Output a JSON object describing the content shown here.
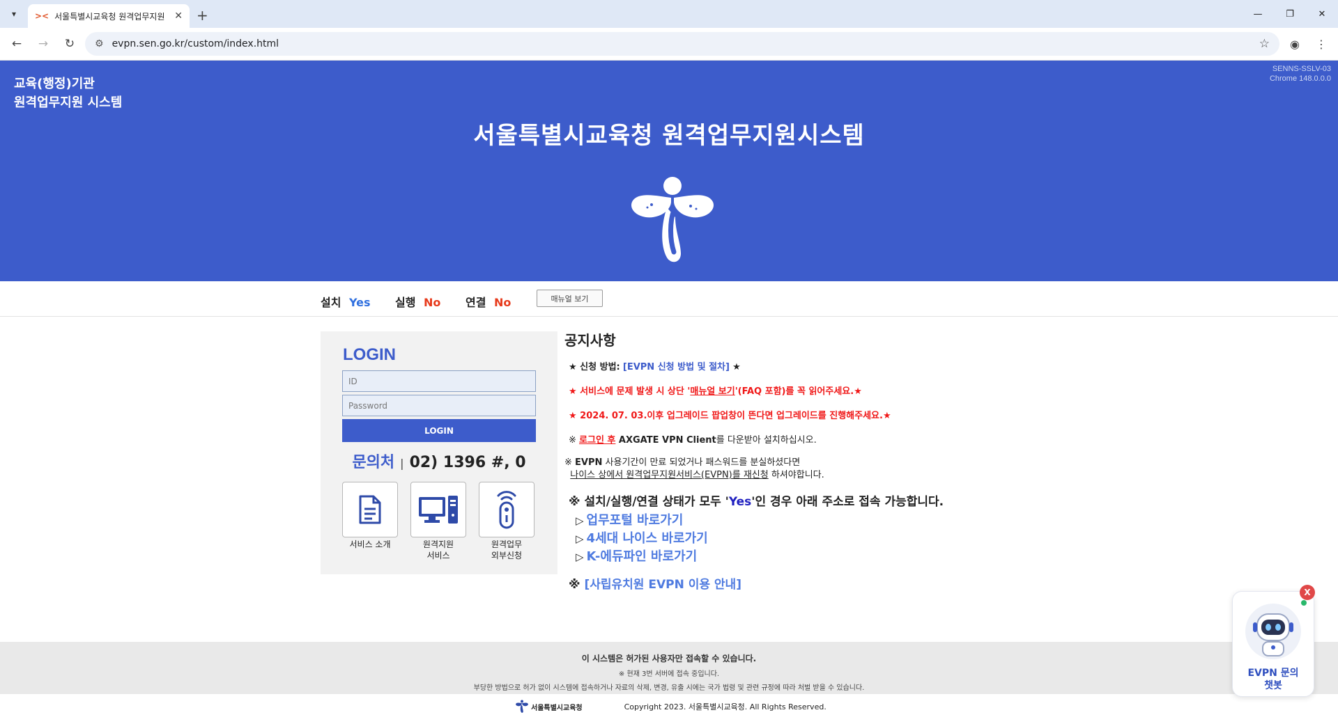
{
  "browser": {
    "tab_title": "서울특별시교육청 원격업무지원",
    "url": "evpn.sen.go.kr/custom/index.html"
  },
  "header": {
    "org_line1": "교육(행정)기관",
    "org_line2": "원격업무지원 시스템",
    "server_line1": "SENNS-SSLV-03",
    "server_line2": "Chrome 148.0.0.0",
    "title": "서울특별시교육청 원격업무지원시스템"
  },
  "status": {
    "install_label": "설치",
    "install_value": "Yes",
    "run_label": "실행",
    "run_value": "No",
    "connect_label": "연결",
    "connect_value": "No",
    "manual_button": "매뉴얼 보기"
  },
  "login": {
    "title": "LOGIN",
    "id_placeholder": "ID",
    "password_placeholder": "Password",
    "button": "LOGIN",
    "contact_label": "문의처",
    "contact_number": "02) 1396 #, 0",
    "services": [
      {
        "label": "서비스 소개",
        "label2": "",
        "icon": "document-icon"
      },
      {
        "label": "원격지원",
        "label2": "서비스",
        "icon": "computer-icon"
      },
      {
        "label": "원격업무",
        "label2": "외부신청",
        "icon": "remote-icon"
      }
    ]
  },
  "notice": {
    "title": "공지사항",
    "apply_prefix": "★ 신청 방법:",
    "apply_link": "[EVPN 신청 방법 및 절차]",
    "apply_suffix": "★",
    "problem_a": "★ 서비스에 문제 발생 시 상단 '",
    "problem_link": "매뉴얼 보기",
    "problem_b": "'(FAQ 포함)를 꼭 읽어주세요.★",
    "upgrade_date": "★ 2024. 07. 03.",
    "upgrade_text": "이후 업그레이드 팝업창이 뜬다면 업그레이드를 진행해주세요.★",
    "client_prefix": "※ ",
    "client_link": "로그인 후",
    "client_bold": " AXGATE VPN Client",
    "client_suffix": "를 다운받아 설치하십시오.",
    "expire_line1_prefix": "※ ",
    "expire_line1_bold": "EVPN",
    "expire_line1_suffix": " 사용기간이 만료 되었거나 패스워드를 분실하셨다면",
    "expire_line2_link": "나이스 상에서 원격업무지원서비스(EVPN)를 재신청",
    "expire_line2_suffix": " 하셔야합니다.",
    "status_a": "※ 설치/실행/연결 상태가 모두 '",
    "status_yes": "Yes",
    "status_b": "'인 경우 아래 주소로 접속 가능합니다.",
    "links": [
      "업무포털 바로가기",
      "4세대 나이스 바로가기",
      "K-에듀파인 바로가기"
    ],
    "private_prefix": "※ ",
    "private_link": "[사립유치원 EVPN 이용 안내]"
  },
  "footer": {
    "line1": "이 시스템은 허가된 사용자만 접속할 수 있습니다.",
    "line2": "※ 현재 3번 서버에 접속 중입니다.",
    "line3": "부당한 방법으로 허가 없이 시스템에 접속하거나 자료의 삭제, 변경, 유출 시에는 국가 법령 및 관련 규정에 따라 처벌 받을 수 있습니다.",
    "brand": "서울특별시교육청",
    "copyright": "Copyright 2023. 서울특별시교육청. All Rights Reserved."
  },
  "chatbot": {
    "close": "X",
    "line1": "EVPN 문의",
    "line2": "챗봇"
  },
  "colors": {
    "brand_blue": "#3d5ccb",
    "yes": "#2f6fdf",
    "no": "#e73a1b",
    "notice_red": "#f01818"
  }
}
